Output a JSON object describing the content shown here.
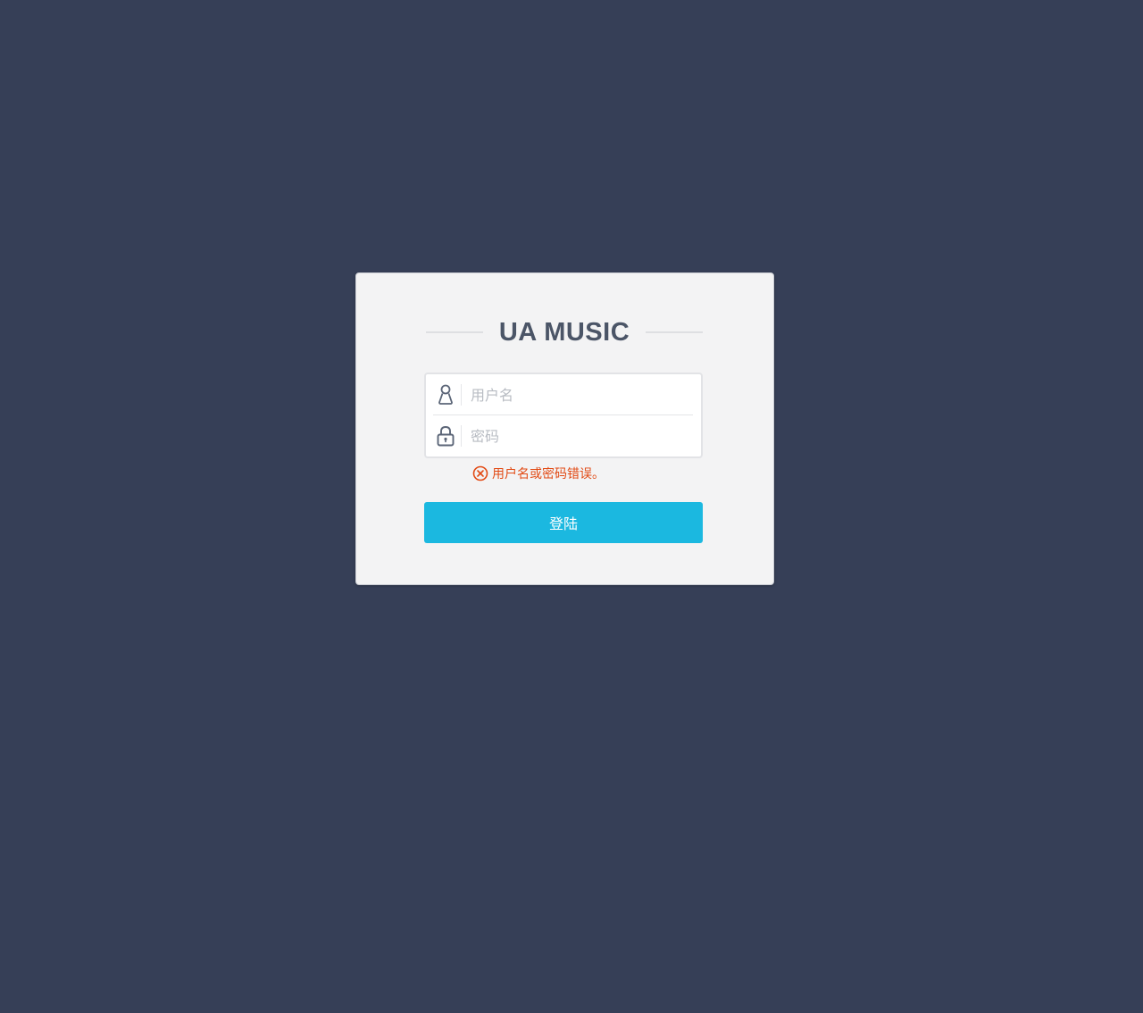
{
  "login": {
    "title": "UA MUSIC",
    "username": {
      "value": "",
      "placeholder": "用户名",
      "icon": "user-icon"
    },
    "password": {
      "value": "",
      "placeholder": "密码",
      "icon": "lock-icon"
    },
    "error": {
      "text": "用户名或密码错误。",
      "icon": "error-circle-x-icon",
      "color": "#e24a14"
    },
    "submit_label": "登陆"
  },
  "colors": {
    "background": "#363f57",
    "card": "#f3f3f4",
    "accent": "#1bb8e0",
    "title": "#4b5567"
  }
}
